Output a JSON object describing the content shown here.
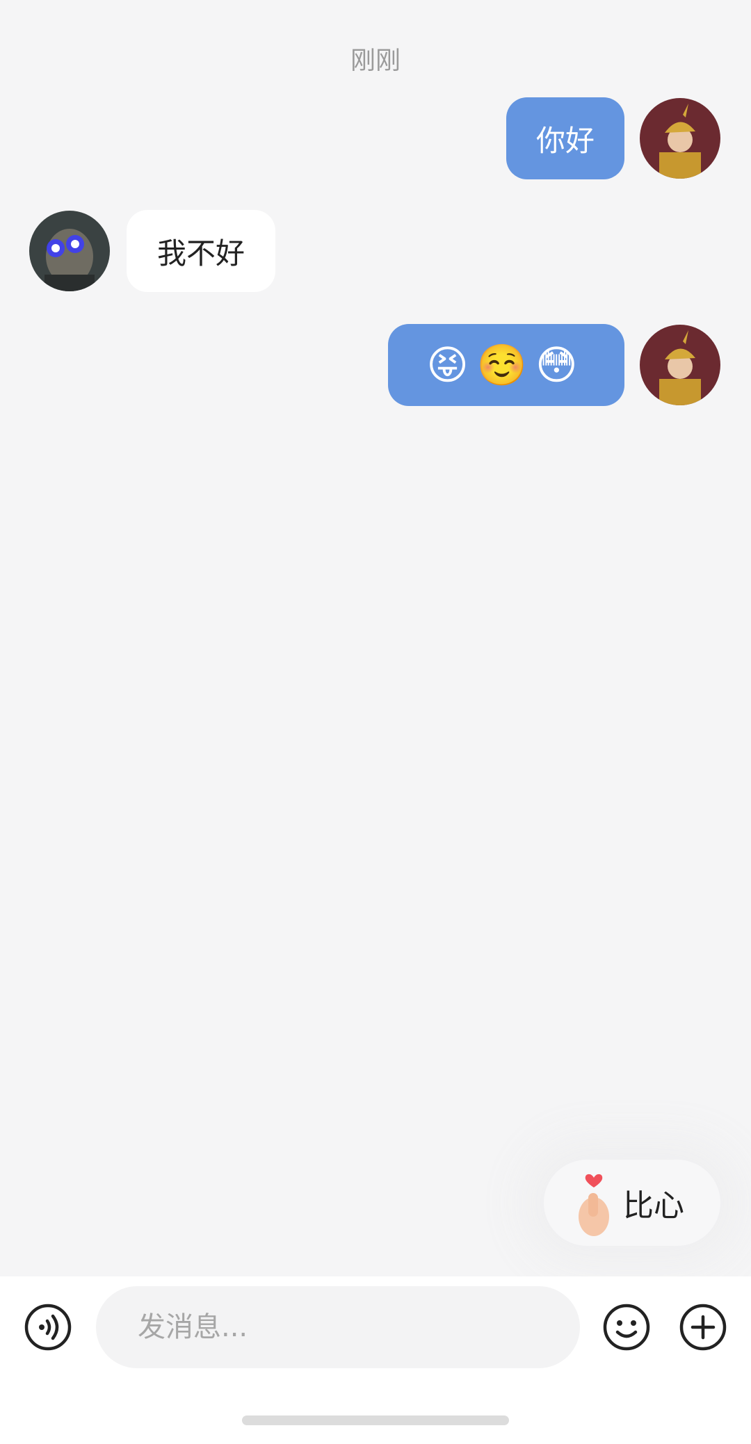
{
  "chat": {
    "timestamp": "刚刚",
    "messages": [
      {
        "direction": "out",
        "text": "你好"
      },
      {
        "direction": "in",
        "text": "我不好"
      },
      {
        "direction": "out",
        "text": "😝☺️😳"
      }
    ]
  },
  "quick_reaction": {
    "label": "比心",
    "icon": "finger-heart-icon"
  },
  "input_bar": {
    "placeholder": "发消息...",
    "value": "",
    "voice_icon": "voice-icon",
    "emoji_icon": "emoji-icon",
    "add_icon": "plus-circle-icon"
  },
  "colors": {
    "background": "#f5f5f6",
    "outgoing_bubble": "#6495e0",
    "incoming_bubble": "#ffffff",
    "timestamp_text": "#9a9a9a"
  }
}
